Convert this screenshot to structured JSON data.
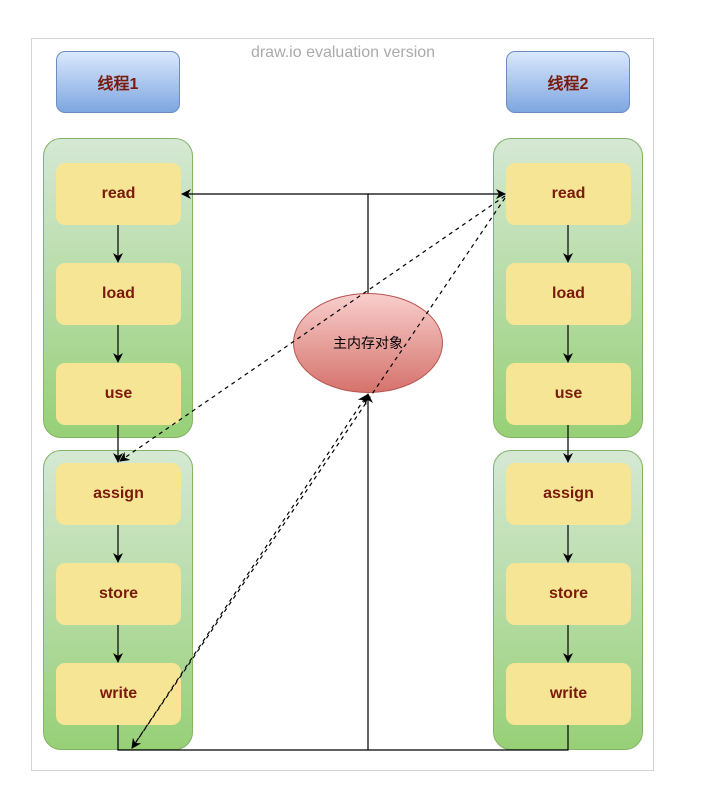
{
  "watermark": "draw.io evaluation version",
  "threads": [
    {
      "label": "线程1"
    },
    {
      "label": "线程2"
    }
  ],
  "steps": [
    "read",
    "load",
    "use",
    "assign",
    "store",
    "write"
  ],
  "main_memory": {
    "label": "主内存对象"
  },
  "colors": {
    "thread_fill_top": "#dae8fc",
    "thread_fill_bottom": "#7ea6e0",
    "group_fill_top": "#d5e8d4",
    "group_fill_bottom": "#97d077",
    "step_fill": "#f6e594",
    "ellipse_fill_top": "#f8cecc",
    "ellipse_fill_bottom": "#d5736c",
    "label_text": "#7a1a0a"
  }
}
